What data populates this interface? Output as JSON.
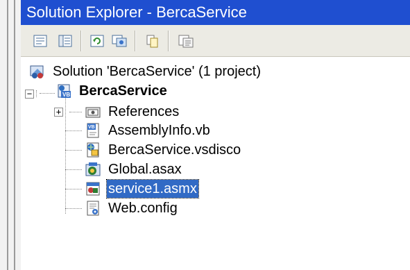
{
  "window": {
    "title": "Solution Explorer - BercaService"
  },
  "toolbar": {
    "buttons": [
      {
        "name": "properties-icon"
      },
      {
        "name": "show-all-files-icon"
      },
      {
        "name": "refresh-icon"
      },
      {
        "name": "view-designer-icon"
      },
      {
        "name": "copy-project-icon"
      },
      {
        "name": "view-code-icon"
      }
    ]
  },
  "tree": {
    "solution": {
      "label": "Solution 'BercaService' (1 project)",
      "icon": "solution-icon"
    },
    "project": {
      "label": "BercaService",
      "icon": "vb-project-icon",
      "expander": "−"
    },
    "items": [
      {
        "label": "References",
        "icon": "references-folder-icon",
        "expander": "+"
      },
      {
        "label": "AssemblyInfo.vb",
        "icon": "vb-file-icon"
      },
      {
        "label": "BercaService.vsdisco",
        "icon": "vsdisco-file-icon"
      },
      {
        "label": "Global.asax",
        "icon": "global-asax-icon"
      },
      {
        "label": "service1.asmx",
        "icon": "asmx-file-icon",
        "selected": true
      },
      {
        "label": "Web.config",
        "icon": "config-file-icon"
      }
    ]
  },
  "colors": {
    "titlebar": "#1f4fd0",
    "selection": "#316ac5",
    "toolbar": "#ecebe4"
  }
}
